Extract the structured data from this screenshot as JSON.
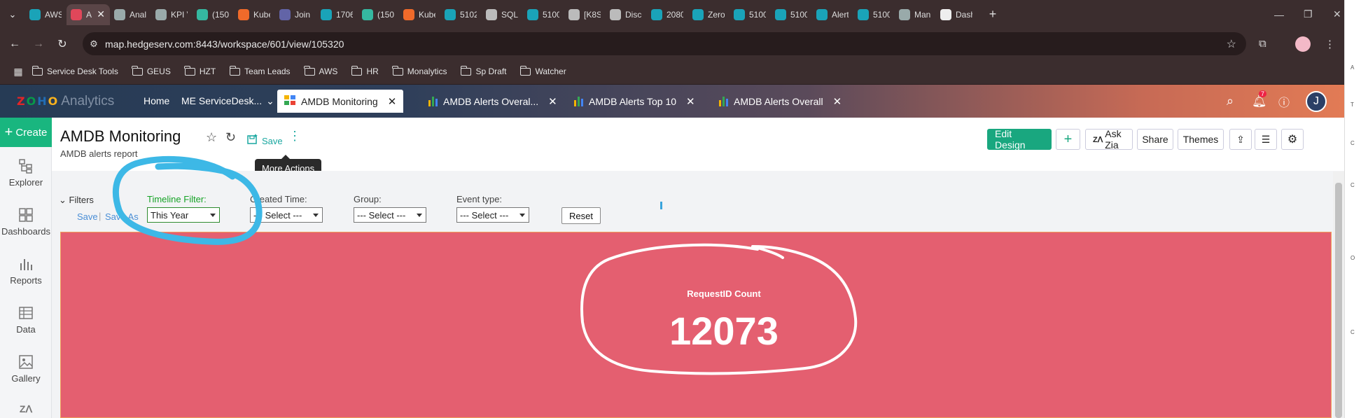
{
  "browser": {
    "tabs": [
      {
        "label": "AWS",
        "icon": "s-icon",
        "color": "#1aa3b8"
      },
      {
        "label": "A",
        "icon": "analytics-icon",
        "color": "#e0475a",
        "active": true
      },
      {
        "label": "Anal",
        "icon": "swirl-icon",
        "color": "#9aa"
      },
      {
        "label": "KPI V",
        "icon": "swirl-icon",
        "color": "#9aa"
      },
      {
        "label": "(150)",
        "icon": "sq-icon",
        "color": "#35b8a0"
      },
      {
        "label": "Kube",
        "icon": "grafana-icon",
        "color": "#f06a2a"
      },
      {
        "label": "Join",
        "icon": "teams-icon",
        "color": "#6264a7"
      },
      {
        "label": "1706",
        "icon": "s-icon",
        "color": "#1aa3b8"
      },
      {
        "label": "(150)",
        "icon": "sq-icon",
        "color": "#35b8a0"
      },
      {
        "label": "Kube",
        "icon": "grafana-icon",
        "color": "#f06a2a"
      },
      {
        "label": "5102",
        "icon": "s-icon",
        "color": "#1aa3b8"
      },
      {
        "label": "SQL",
        "icon": "globe-icon",
        "color": "#bbb"
      },
      {
        "label": "5100",
        "icon": "s-icon",
        "color": "#1aa3b8"
      },
      {
        "label": "[K8S",
        "icon": "globe-icon",
        "color": "#bbb"
      },
      {
        "label": "Disco",
        "icon": "globe-icon",
        "color": "#bbb"
      },
      {
        "label": "2080",
        "icon": "s-icon",
        "color": "#1aa3b8"
      },
      {
        "label": "Zero",
        "icon": "s-icon",
        "color": "#1aa3b8"
      },
      {
        "label": "5100",
        "icon": "s-icon",
        "color": "#1aa3b8"
      },
      {
        "label": "5100",
        "icon": "s-icon",
        "color": "#1aa3b8"
      },
      {
        "label": "Alert",
        "icon": "s-icon",
        "color": "#1aa3b8"
      },
      {
        "label": "5100",
        "icon": "s-icon",
        "color": "#1aa3b8"
      },
      {
        "label": "Man",
        "icon": "swirl-icon",
        "color": "#9aa"
      },
      {
        "label": "Dash",
        "icon": "doc-icon",
        "color": "#eee"
      }
    ],
    "new_tab": "+",
    "url": "map.hedgeserv.com:8443/workspace/601/view/105320"
  },
  "bookmarks": [
    "Service Desk Tools",
    "GEUS",
    "HZT",
    "Team Leads",
    "AWS",
    "HR",
    "Monalytics",
    "Sp Draft",
    "Watcher"
  ],
  "zoho": {
    "logo_text": [
      "Z",
      "O",
      "H",
      "O"
    ],
    "logo_colors": [
      "#e42527",
      "#089949",
      "#226db4",
      "#f9b21d"
    ],
    "product": "Analytics",
    "nav": {
      "home": "Home",
      "servicedesk": "ME ServiceDesk..."
    },
    "tabs": [
      {
        "label": "AMDB Monitoring",
        "active": true
      },
      {
        "label": "AMDB Alerts Overal..."
      },
      {
        "label": "AMDB Alerts Top 10"
      },
      {
        "label": "AMDB Alerts Overall"
      }
    ],
    "notification_count": "7",
    "user_initial": "J"
  },
  "rail": {
    "create": "Create",
    "items": [
      "Explorer",
      "Dashboards",
      "Reports",
      "Data",
      "Gallery"
    ]
  },
  "dashboard": {
    "title": "AMDB Monitoring",
    "subtitle": "AMDB alerts report",
    "save": "Save",
    "tooltip": "More Actions",
    "buttons": {
      "edit_design": "Edit Design",
      "ask_zia": "Ask Zia",
      "share": "Share",
      "themes": "Themes"
    },
    "filters": {
      "toggle": "Filters",
      "save": "Save",
      "save_as": "Save As",
      "timeline_label": "Timeline Filter:",
      "timeline_value": "This Year",
      "created_label": "Created Time:",
      "created_value": "--- Select ---",
      "group_label": "Group:",
      "group_value": "--- Select ---",
      "event_label": "Event type:",
      "event_value": "--- Select ---",
      "reset": "Reset"
    },
    "kpi": {
      "label": "RequestID Count",
      "value": "12073",
      "color": "#e45f70"
    }
  },
  "colors": {
    "accent": "#19b67f",
    "filter_label": "#17a327",
    "annotation_blue": "#3db8e6"
  }
}
